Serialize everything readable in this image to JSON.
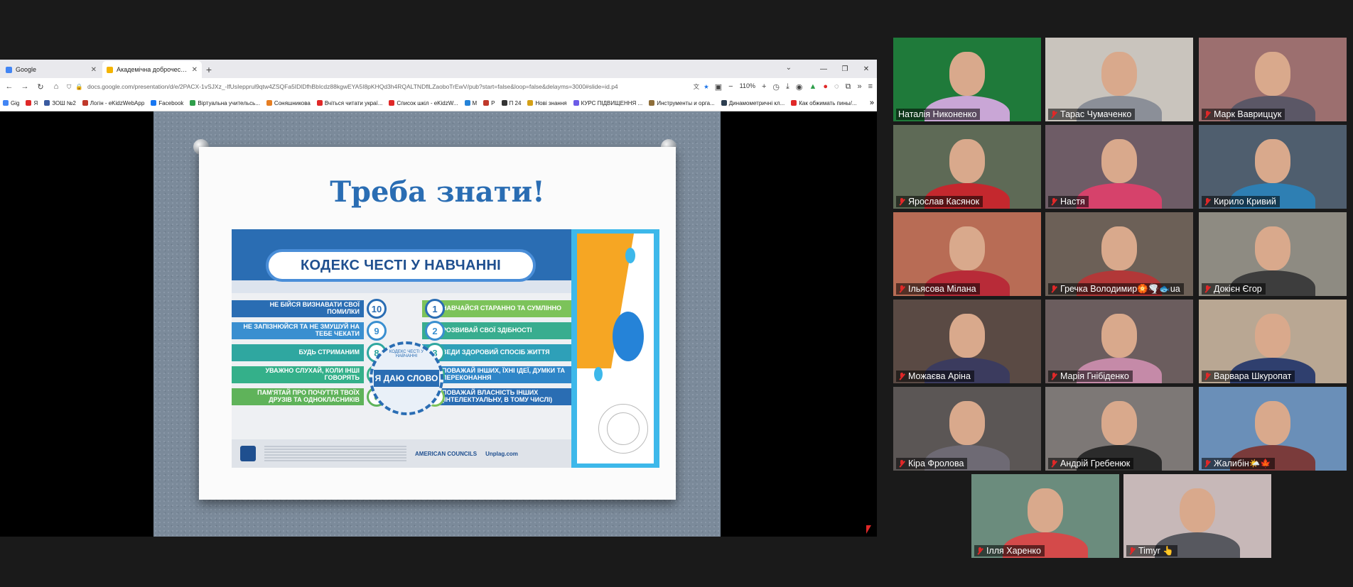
{
  "browser": {
    "tabs": [
      {
        "title": "Google",
        "active": false
      },
      {
        "title": "Академічна доброчесність - G",
        "active": true
      }
    ],
    "new_tab": "+",
    "url": "docs.google.com/presentation/d/e/2PACX-1vSJXz_-lfUsIepprul9qtw4ZSQFa5IDlDfhBbIcdz88kgwEYA5I8pKHQd3h4RQALTNDflLZaoboTrEwV/pub?start=false&loop=false&delayms=3000#slide=id.p4",
    "zoom": "110%",
    "bookmarks": [
      "Gig",
      "Я",
      "ЗОШ №2",
      "Логін - eKidzWebApp",
      "Facebook",
      "Віртуальна учительсь...",
      "Соняшникова",
      "Вчіться читати украї...",
      "Список шкіл - eKidzW...",
      "M",
      "P",
      "П 24",
      "Нові знання",
      "КУРС ПІДВИЩЕННЯ ...",
      "Инструменты и орга...",
      "Динамометричні кл...",
      "Как обжимать пины/..."
    ]
  },
  "slide": {
    "title": "Треба знати!",
    "poster_heading": "КОДЕКС ЧЕСТІ У НАВЧАННІ",
    "seal_text": "Я ДАЮ СЛОВО",
    "seal_ring": "КОДЕКС ЧЕСТІ У НАВЧАННІ",
    "left_rules": [
      {
        "num": "10",
        "text": "НЕ БІЙСЯ ВИЗНАВАТИ СВОЇ ПОМИЛКИ"
      },
      {
        "num": "9",
        "text": "НЕ ЗАПІЗНЮЙСЯ ТА НЕ ЗМУШУЙ НА ТЕБЕ ЧЕКАТИ"
      },
      {
        "num": "8",
        "text": "БУДЬ СТРИМАНИМ"
      },
      {
        "num": "7",
        "text": "УВАЖНО СЛУХАЙ, КОЛИ ІНШІ ГОВОРЯТЬ"
      },
      {
        "num": "6",
        "text": "ПАМ'ЯТАЙ ПРО ПОЧУТТЯ ТВОЇХ ДРУЗІВ ТА ОДНОКЛАСНИКІВ"
      }
    ],
    "right_rules": [
      {
        "num": "1",
        "text": "НАВЧАЙСЯ СТАРАННО ТА СУМЛІННО"
      },
      {
        "num": "2",
        "text": "РОЗВИВАЙ СВОЇ ЗДІБНОСТІ"
      },
      {
        "num": "3",
        "text": "ВЕДИ ЗДОРОВИЙ СПОСІБ ЖИТТЯ"
      },
      {
        "num": "4",
        "text": "ПОВАЖАЙ ІНШИХ, ЇХНІ ІДЕЇ, ДУМКИ ТА ПЕРЕКОНАННЯ"
      },
      {
        "num": "5",
        "text": "ПОВАЖАЙ ВЛАСНІСТЬ ІНШИХ (ІНТЕЛЕКТУАЛЬНУ, В ТОМУ ЧИСЛІ)"
      }
    ],
    "footer_logos": [
      "AMERICAN COUNCILS",
      "Unplag.com"
    ]
  },
  "participants": [
    {
      "name": "Наталія Никоненко",
      "muted": false,
      "speaking": true,
      "bg": "#1f7a3a",
      "shirt": "#c9a6d6"
    },
    {
      "name": "Тарас Чумаченко",
      "muted": true,
      "bg": "#c9c4bd",
      "shirt": "#8b8f98"
    },
    {
      "name": "Марк Вавриццук",
      "muted": true,
      "bg": "#9c6f6f",
      "shirt": "#5b5766"
    },
    {
      "name": "Ярослав Касянок",
      "muted": true,
      "bg": "#5e6a56",
      "shirt": "#c4282e"
    },
    {
      "name": "Настя",
      "muted": true,
      "bg": "#6e5c66",
      "shirt": "#d6426b"
    },
    {
      "name": "Кирило Кривий",
      "muted": true,
      "bg": "#4f5e6e",
      "shirt": "#2e7fb3"
    },
    {
      "name": "Ільясова Мілана",
      "muted": true,
      "bg": "#b86c55",
      "shirt": "#b82b38"
    },
    {
      "name": "Гречка Володимир🏵️🌪️🐟ua",
      "muted": true,
      "bg": "#6c6057",
      "shirt": "#b23838"
    },
    {
      "name": "Докієн Єгор",
      "muted": true,
      "bg": "#8e8b82",
      "shirt": "#3d3d3d"
    },
    {
      "name": "Можаєва Аріна",
      "muted": true,
      "bg": "#5a4a44",
      "shirt": "#3b3b5e"
    },
    {
      "name": "Марія Гнібіденко",
      "muted": true,
      "bg": "#6b5d5e",
      "shirt": "#c58aa8"
    },
    {
      "name": "Варвара Шкуропат",
      "muted": true,
      "bg": "#b9a793",
      "shirt": "#2f3f6e"
    },
    {
      "name": "Кіра Фролова",
      "muted": true,
      "bg": "#5b5655",
      "shirt": "#6e6a74"
    },
    {
      "name": "Андрій Гребенюк",
      "muted": true,
      "bg": "#7d7876",
      "shirt": "#2b2b2b"
    },
    {
      "name": "Жалибін🌤️🍁",
      "muted": true,
      "bg": "#6a8fb8",
      "shirt": "#7a3b3b"
    },
    {
      "name": "Ілля Харенко",
      "muted": true,
      "bg": "#6b8c7d",
      "shirt": "#d44a4a"
    },
    {
      "name": "Timyr 👆",
      "muted": true,
      "bg": "#c7b8b8",
      "shirt": "#57585f"
    }
  ],
  "colors": {
    "accent_speaking": "#b9e25a",
    "muted_icon": "#e02828",
    "slide_title": "#2a6db3"
  }
}
